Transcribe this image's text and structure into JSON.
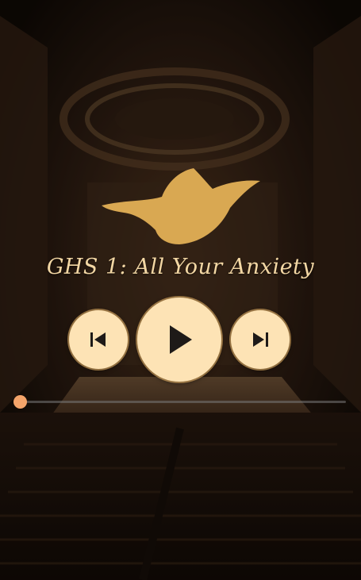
{
  "player": {
    "track_title": "GHS 1: All Your Anxiety",
    "progress": 0.0,
    "controls": {
      "previous_icon": "skip-previous-icon",
      "play_icon": "play-icon",
      "next_icon": "skip-next-icon"
    }
  },
  "branding": {
    "logo_icon": "dove-icon"
  },
  "colors": {
    "accent": "#f4a46a",
    "button_bg": "#fde3b5",
    "logo": "#d9a852",
    "title": "#f3d7a4"
  }
}
